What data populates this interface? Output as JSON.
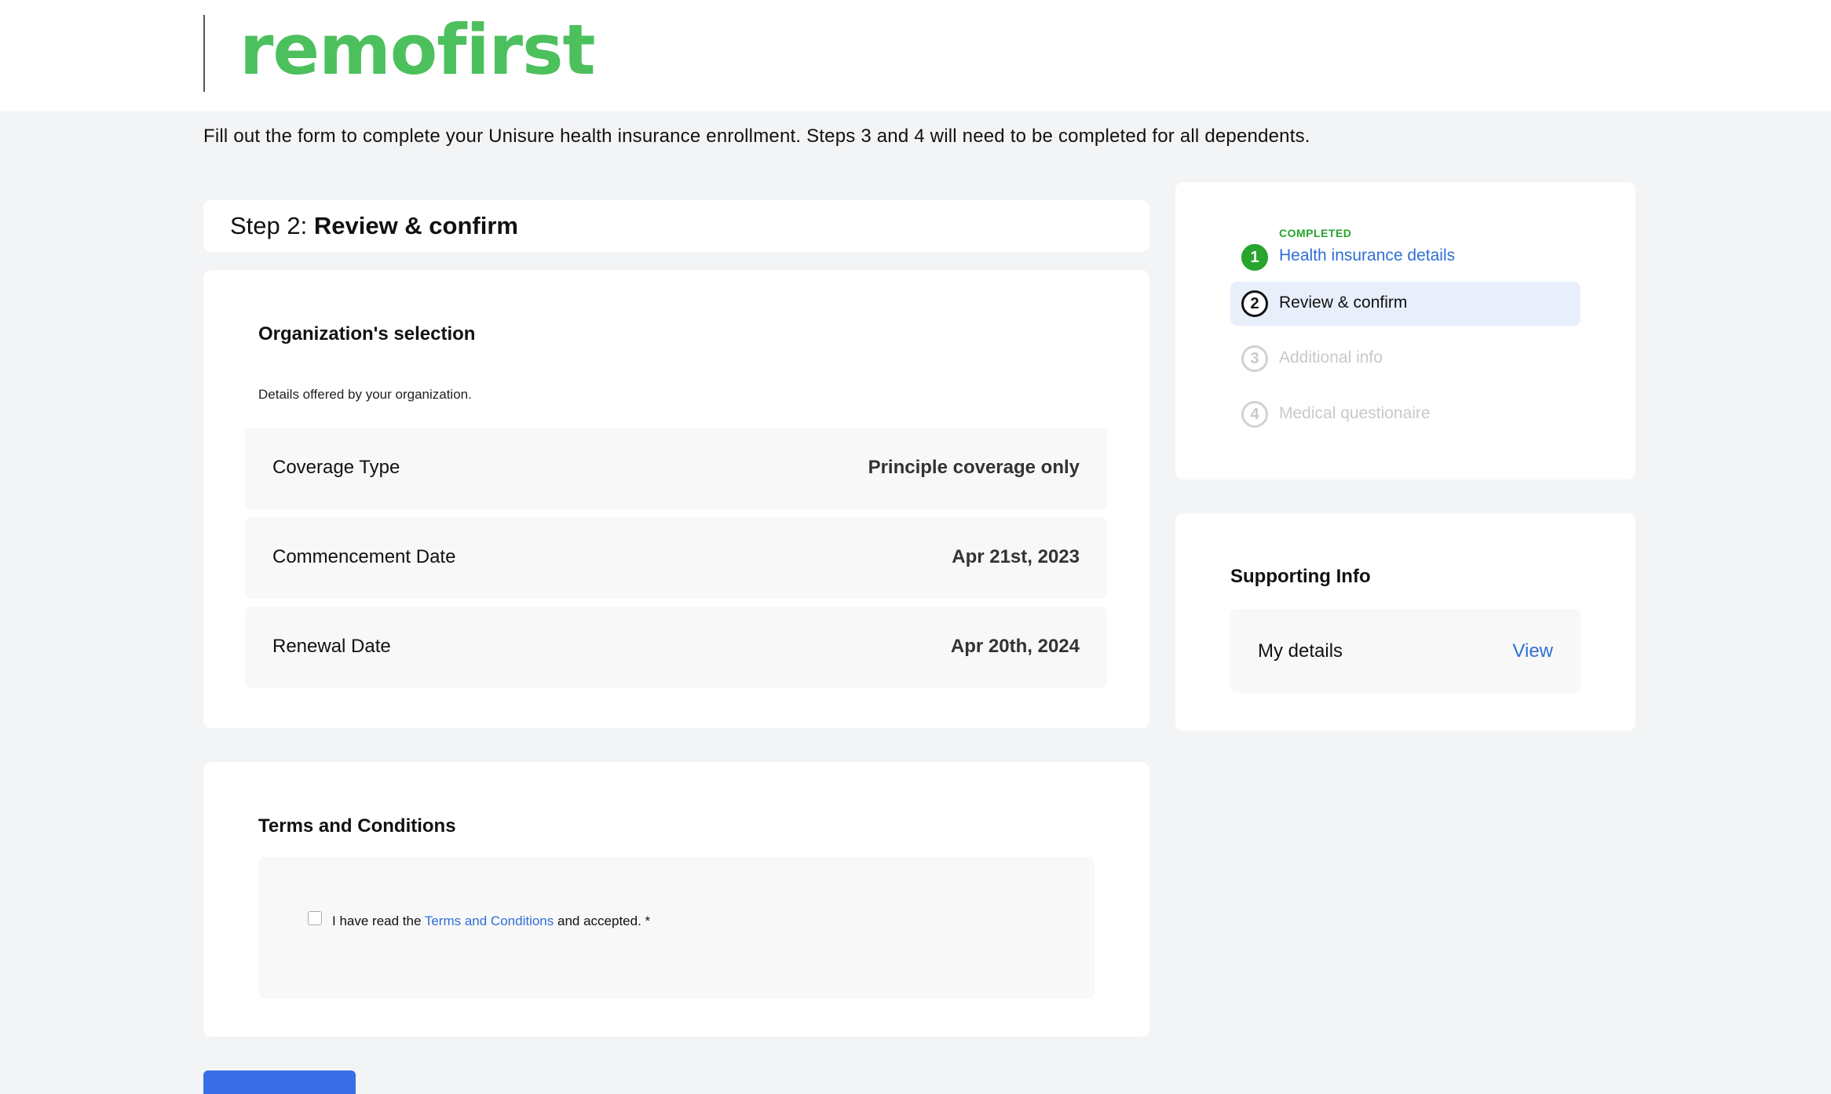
{
  "header": {
    "logo_text": "remofirst"
  },
  "intro": "Fill out the form to complete your Unisure health insurance enrollment. Steps 3 and 4 will need to be completed for all dependents.",
  "step_header": {
    "prefix": "Step 2: ",
    "title": "Review & confirm"
  },
  "organization": {
    "title": "Organization's selection",
    "description": "Details offered by your organization.",
    "rows": [
      {
        "label": "Coverage Type",
        "value": "Principle coverage only"
      },
      {
        "label": "Commencement Date",
        "value": "Apr 21st, 2023"
      },
      {
        "label": "Renewal Date",
        "value": "Apr 20th, 2024"
      }
    ]
  },
  "terms": {
    "title": "Terms and Conditions",
    "text_before": "I have read the ",
    "link_text": "Terms and Conditions",
    "text_after": " and accepted. *",
    "checked": false
  },
  "steps": {
    "completed_label": "COMPLETED",
    "items": [
      {
        "number": "1",
        "label": "Health insurance details",
        "state": "completed"
      },
      {
        "number": "2",
        "label": "Review & confirm",
        "state": "active"
      },
      {
        "number": "3",
        "label": "Additional info",
        "state": "pending"
      },
      {
        "number": "4",
        "label": "Medical questionaire",
        "state": "pending"
      }
    ]
  },
  "supporting": {
    "title": "Supporting Info",
    "row_label": "My details",
    "row_action": "View"
  },
  "colors": {
    "brand_green": "#4cc05c",
    "completed_green": "#27a52c",
    "link_blue": "#2f6fd6",
    "button_blue": "#3a6ee8",
    "pending_gray": "#c9c9c9"
  }
}
